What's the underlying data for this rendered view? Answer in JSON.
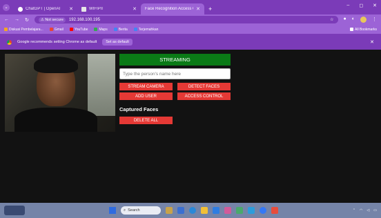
{
  "browser": {
    "tabs": [
      {
        "title": "ChatGPT | OpenAI",
        "favicon": "chatgpt-icon"
      },
      {
        "title": "WIFIPII",
        "favicon": "page-icon"
      },
      {
        "title": "Face Recognition Access Contr",
        "favicon": "none",
        "active": true
      }
    ],
    "new_tab": "+",
    "window_controls": {
      "minimize": "–",
      "maximize": "◻",
      "close": "✕"
    },
    "address": {
      "not_secure": "⚠ Not secure",
      "url": "192.168.100.195"
    },
    "bookmarks": [
      {
        "label": "Diskusi Pembelajara...",
        "color": "#f5a623"
      },
      {
        "label": "Gmail",
        "color": "#ea4335"
      },
      {
        "label": "YouTube",
        "color": "#ff0000"
      },
      {
        "label": "Maps",
        "color": "#34a853"
      },
      {
        "label": "Berita",
        "color": "#4285f4"
      },
      {
        "label": "Terjemahkan",
        "color": "#4285f4"
      }
    ],
    "all_bookmarks": "All Bookmarks",
    "infobar": {
      "message": "Google recommends setting Chrome as default",
      "button": "Set as default",
      "close": "✕"
    }
  },
  "app": {
    "status": "STREAMING",
    "name_placeholder": "Type the person's name here",
    "buttons": {
      "stream_camera": "STREAM CAMERA",
      "detect_faces": "DETECT FACES",
      "add_user": "ADD USER",
      "access_control": "ACCESS CONTROL",
      "delete_all": "DELETE ALL"
    },
    "captured_title": "Captured Faces"
  },
  "taskbar": {
    "search_placeholder": "Search"
  },
  "colors": {
    "browser_purple": "#7b3bb8",
    "streaming_green": "#0a7a16",
    "button_red": "#e53935",
    "page_bg": "#121212"
  }
}
